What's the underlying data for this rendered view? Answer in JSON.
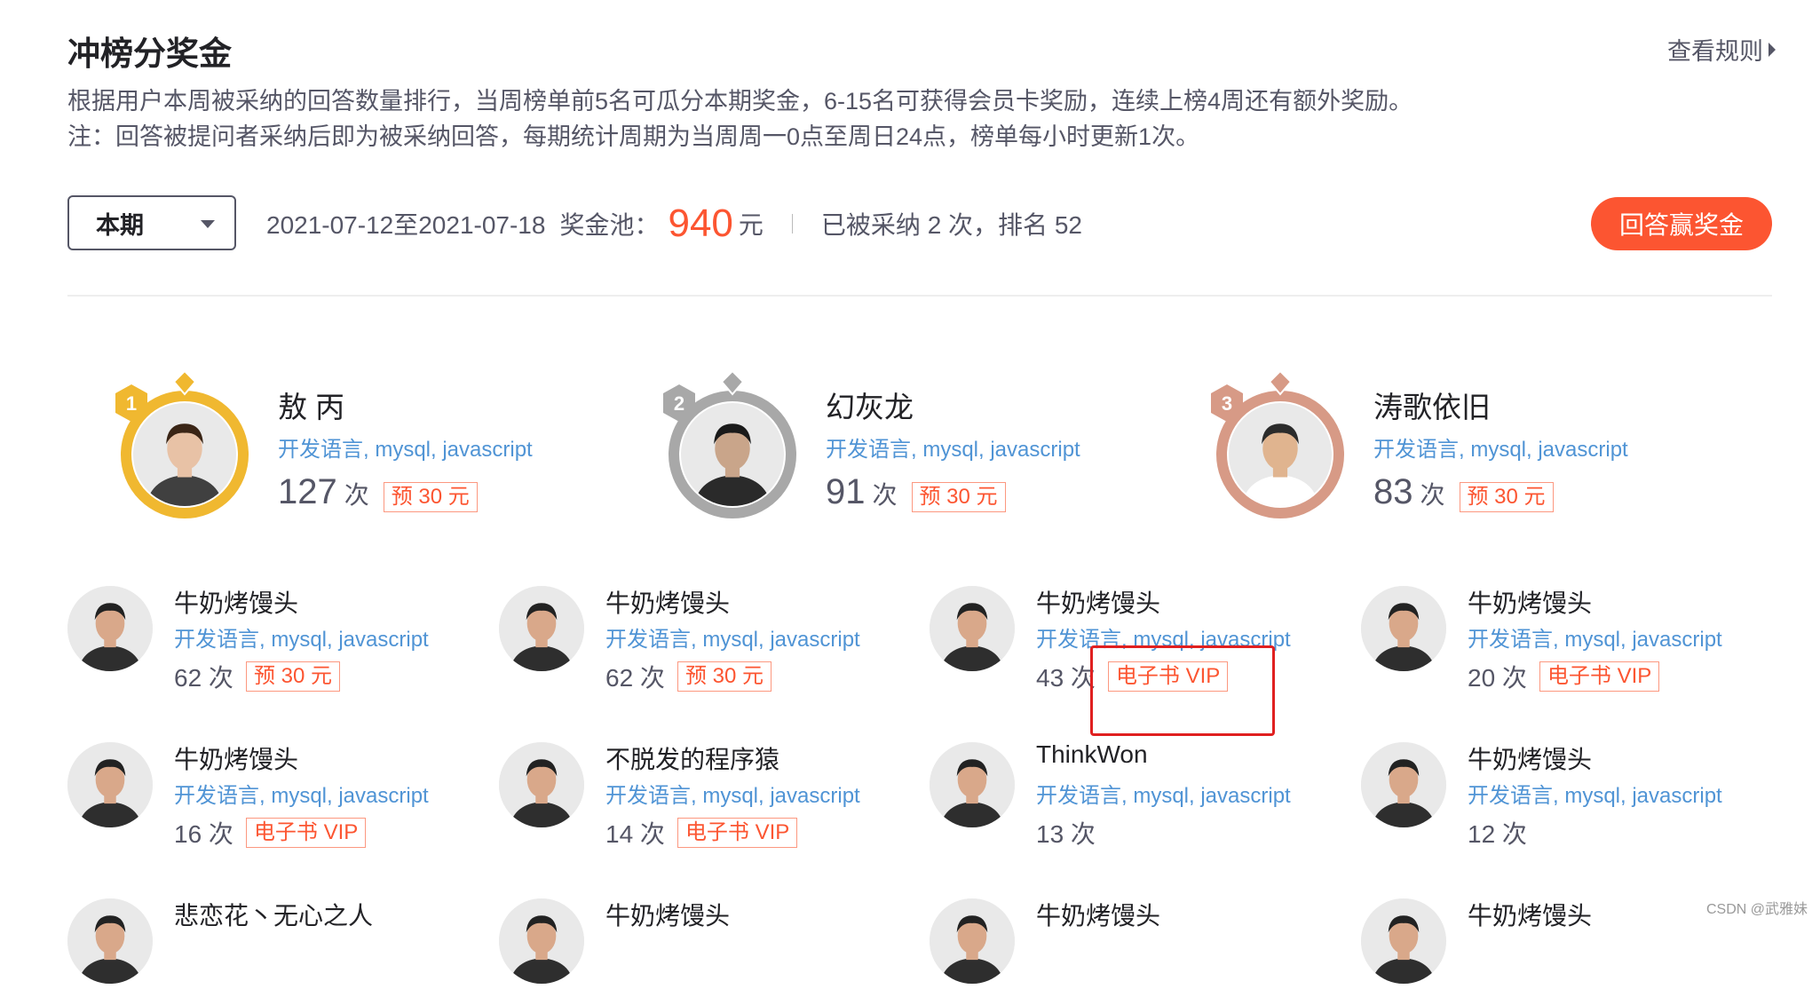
{
  "header": {
    "title": "冲榜分奖金",
    "rules_link": "查看规则"
  },
  "description": {
    "line1": "根据用户本周被采纳的回答数量排行，当周榜单前5名可瓜分本期奖金，6-15名可获得会员卡奖励，连续上榜4周还有额外奖励。",
    "line2": "注：回答被提问者采纳后即为被采纳回答，每期统计周期为当周周一0点至周日24点，榜单每小时更新1次。"
  },
  "period": {
    "selected": "本期",
    "date_range": "2021-07-12至2021-07-18",
    "pool_label": "奖金池：",
    "pool_amount": "940",
    "pool_unit": "元",
    "my_status": "已被采纳 2 次，排名 52",
    "cta_button": "回答赢奖金"
  },
  "top3": [
    {
      "rank": "1",
      "name": "敖 丙",
      "tags": "开发语言, mysql, javascript",
      "count": "127",
      "unit": "次",
      "reward": "预 30 元",
      "medal_color": "#f0b830"
    },
    {
      "rank": "2",
      "name": "幻灰龙",
      "tags": "开发语言, mysql, javascript",
      "count": "91",
      "unit": "次",
      "reward": "预 30 元",
      "medal_color": "#a8a8a8"
    },
    {
      "rank": "3",
      "name": "涛歌依旧",
      "tags": "开发语言, mysql, javascript",
      "count": "83",
      "unit": "次",
      "reward": "预 30 元",
      "medal_color": "#d79a86"
    }
  ],
  "leaderboard": [
    {
      "name": "牛奶烤馒头",
      "tags": "开发语言, mysql, javascript",
      "count": "62 次",
      "reward": "预 30 元"
    },
    {
      "name": "牛奶烤馒头",
      "tags": "开发语言, mysql, javascript",
      "count": "62 次",
      "reward": "预 30 元"
    },
    {
      "name": "牛奶烤馒头",
      "tags": "开发语言, mysql, javascript",
      "count": "43 次",
      "reward": "电子书 VIP"
    },
    {
      "name": "牛奶烤馒头",
      "tags": "开发语言, mysql, javascript",
      "count": "20 次",
      "reward": "电子书 VIP"
    },
    {
      "name": "牛奶烤馒头",
      "tags": "开发语言, mysql, javascript",
      "count": "16 次",
      "reward": "电子书 VIP"
    },
    {
      "name": "不脱发的程序猿",
      "tags": "开发语言, mysql, javascript",
      "count": "14 次",
      "reward": "电子书 VIP"
    },
    {
      "name": "ThinkWon",
      "tags": "开发语言, mysql, javascript",
      "count": "13 次",
      "reward": ""
    },
    {
      "name": "牛奶烤馒头",
      "tags": "开发语言, mysql, javascript",
      "count": "12 次",
      "reward": ""
    },
    {
      "name": "悲恋花丶无心之人",
      "tags": "",
      "count": "",
      "reward": ""
    },
    {
      "name": "牛奶烤馒头",
      "tags": "",
      "count": "",
      "reward": ""
    },
    {
      "name": "牛奶烤馒头",
      "tags": "",
      "count": "",
      "reward": ""
    },
    {
      "name": "牛奶烤馒头",
      "tags": "",
      "count": "",
      "reward": ""
    }
  ],
  "watermark": "CSDN @武雅妹",
  "colors": {
    "accent": "#fc5531",
    "tag_blue": "#5094d5",
    "highlight_red": "#e02020"
  }
}
